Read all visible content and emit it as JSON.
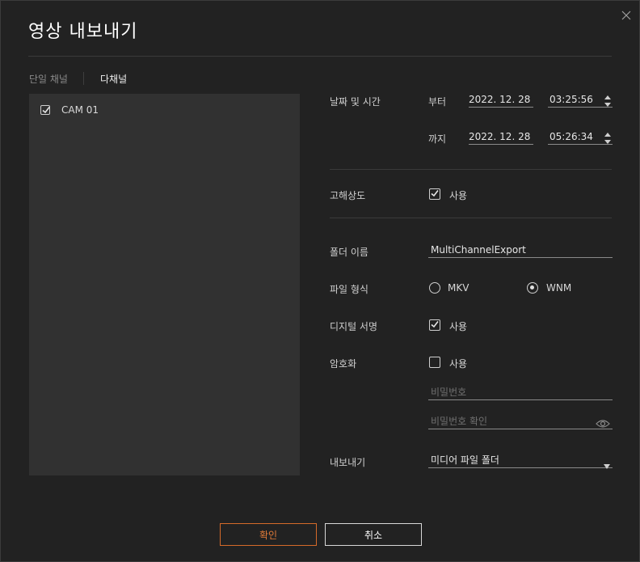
{
  "dialog": {
    "title": "영상 내보내기"
  },
  "tabs": [
    {
      "label": "단일 채널",
      "active": false
    },
    {
      "label": "다채널",
      "active": true
    }
  ],
  "channels": [
    {
      "label": "CAM 01",
      "checked": true
    }
  ],
  "datetime": {
    "label": "날짜 및 시간",
    "from_label": "부터",
    "from_date": "2022. 12. 28",
    "from_time": "03:25:56",
    "to_label": "까지",
    "to_date": "2022. 12. 28",
    "to_time": "05:26:34"
  },
  "high_res": {
    "label": "고해상도",
    "option": "사용",
    "checked": true
  },
  "folder": {
    "label": "폴더 이름",
    "value": "MultiChannelExport"
  },
  "file_format": {
    "label": "파일 형식",
    "options": [
      "MKV",
      "WNM"
    ],
    "selected": "WNM"
  },
  "digital_signature": {
    "label": "디지털 서명",
    "option": "사용",
    "checked": true
  },
  "encryption": {
    "label": "암호화",
    "option": "사용",
    "checked": false,
    "password_placeholder": "비밀번호",
    "confirm_placeholder": "비밀번호 확인"
  },
  "export": {
    "label": "내보내기",
    "value": "미디어 파일 폴더"
  },
  "buttons": {
    "ok": "확인",
    "cancel": "취소"
  },
  "colors": {
    "accent": "#d56a2a",
    "background": "#222222",
    "panel": "#313131"
  }
}
